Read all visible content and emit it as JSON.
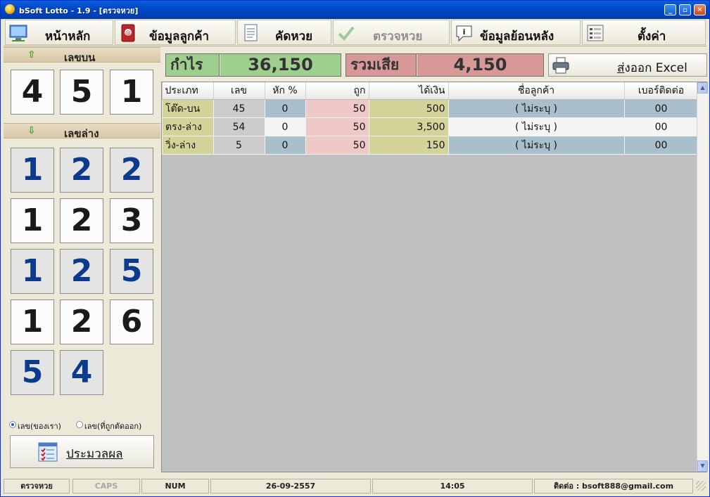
{
  "window": {
    "title": "bSoft Lotto - 1.9 - [ตรวจหวย]"
  },
  "toolbar": {
    "home": "หน้าหลัก",
    "customers": "ข้อมูลลูกค้า",
    "select_lotto": "คัดหวย",
    "check_lotto": "ตรวจหวย",
    "history": "ข้อมูลย้อนหลัง",
    "settings": "ตั้งค่า"
  },
  "upper": {
    "label": "เลขบน",
    "digits": [
      "4",
      "5",
      "1"
    ]
  },
  "lower": {
    "label": "เลขล่าง",
    "rows": [
      [
        "1",
        "2",
        "2"
      ],
      [
        "1",
        "2",
        "3"
      ],
      [
        "1",
        "2",
        "5"
      ],
      [
        "1",
        "2",
        "6"
      ],
      [
        "5",
        "4"
      ]
    ]
  },
  "radios": {
    "ours": "เลข(ของเรา)",
    "cut": "เลข(ที่ถูกตัดออก)",
    "selected": "ours"
  },
  "process_button": "ประมวลผล",
  "summary": {
    "profit_label": "กำไร",
    "profit_value": "36,150",
    "loss_label": "รวมเสีย",
    "loss_value": "4,150"
  },
  "export_button": {
    "prefix": "ส",
    "rest": "่งออก Excel"
  },
  "table": {
    "headers": [
      "ประเภท",
      "เลข",
      "หัก %",
      "ถูก",
      "ได้เงิน",
      "ชื่อลูกค้า",
      "เบอร์ติดต่อ"
    ],
    "rows": [
      [
        "โต๊ด-บน",
        "45",
        "0",
        "50",
        "500",
        "( ไม่ระบุ )",
        "00"
      ],
      [
        "ตรง-ล่าง",
        "54",
        "0",
        "50",
        "3,500",
        "( ไม่ระบุ )",
        "00"
      ],
      [
        "วิ่ง-ล่าง",
        "5",
        "0",
        "50",
        "150",
        "( ไม่ระบุ )",
        "00"
      ]
    ]
  },
  "status": {
    "mode": "ตรวจหวย",
    "caps": "CAPS",
    "num": "NUM",
    "date": "26-09-2557",
    "time": "14:05",
    "contact": "ติดต่อ : bsoft888@gmail.com"
  },
  "colors": {
    "profit_bg": "#9fcf8f",
    "loss_bg": "#d89898",
    "type_col": "#d4d49a",
    "num_col": "#cccccc",
    "pct_col": "#a9bfcc",
    "hit_col": "#efc8c8",
    "money_col": "#d4d49a"
  }
}
